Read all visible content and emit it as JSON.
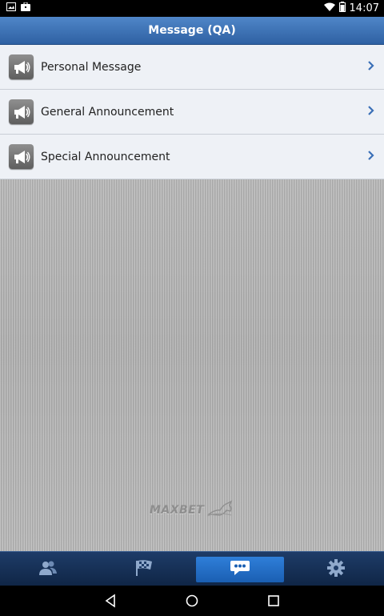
{
  "status_bar": {
    "time": "14:07",
    "left_icons": [
      "image-icon",
      "briefcase-icon"
    ],
    "right_icons": [
      "wifi-icon",
      "battery-icon"
    ]
  },
  "header": {
    "title": "Message (QA)"
  },
  "messages": {
    "items": [
      {
        "label": "Personal Message",
        "icon": "megaphone-icon"
      },
      {
        "label": "General Announcement",
        "icon": "megaphone-icon"
      },
      {
        "label": "Special Announcement",
        "icon": "megaphone-icon"
      }
    ]
  },
  "branding": {
    "logo_text": "MAXBET"
  },
  "tab_bar": {
    "tabs": [
      {
        "name": "tab-contacts",
        "icon": "users-icon",
        "active": false
      },
      {
        "name": "tab-racing",
        "icon": "checkered-flag-icon",
        "active": false
      },
      {
        "name": "tab-messages",
        "icon": "chat-bubble-icon",
        "active": true
      },
      {
        "name": "tab-settings",
        "icon": "gear-icon",
        "active": false
      }
    ]
  },
  "nav_bar": {
    "buttons": [
      "back-icon",
      "home-icon",
      "recents-icon"
    ]
  },
  "colors": {
    "header_gradient_top": "#4f86c8",
    "header_gradient_bottom": "#2f61a3",
    "tab_bar": "#0f2545",
    "active_tab": "#2f7fd9",
    "list_item_bg": "#eef1f6"
  }
}
